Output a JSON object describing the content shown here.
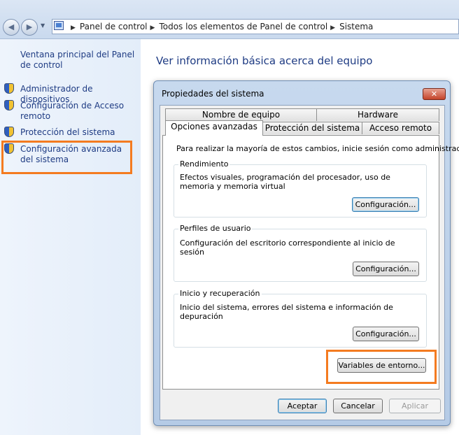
{
  "address_bar": {
    "breadcrumbs": [
      "Panel de control",
      "Todos los elementos de Panel de control",
      "Sistema"
    ]
  },
  "left_pane": {
    "home_link": "Ventana principal del Panel de control",
    "tasks": [
      "Administrador de dispositivos",
      "Configuración de Acceso remoto",
      "Protección del sistema",
      "Configuración avanzada del sistema"
    ]
  },
  "main": {
    "title": "Ver información básica acerca del equipo"
  },
  "dialog": {
    "title": "Propiedades del sistema",
    "close_glyph": "✕",
    "tabs_back": [
      "Nombre de equipo",
      "Hardware"
    ],
    "tabs_front": [
      "Opciones avanzadas",
      "Protección del sistema",
      "Acceso remoto"
    ],
    "active_tab": "Opciones avanzadas",
    "admin_note": "Para realizar la mayoría de estos cambios, inicie sesión como administrador.",
    "groups": [
      {
        "label": "Rendimiento",
        "text": "Efectos visuales, programación del procesador, uso de memoria y memoria virtual",
        "button": "Configuración..."
      },
      {
        "label": "Perfiles de usuario",
        "text": "Configuración del escritorio correspondiente al inicio de sesión",
        "button": "Configuración..."
      },
      {
        "label": "Inicio y recuperación",
        "text": "Inicio del sistema, errores del sistema e información de depuración",
        "button": "Configuración..."
      }
    ],
    "env_button": "Variables de entorno...",
    "footer": {
      "ok": "Aceptar",
      "cancel": "Cancelar",
      "apply": "Aplicar"
    }
  },
  "colors": {
    "highlight": "#f47b20",
    "link": "#1e3b83"
  }
}
